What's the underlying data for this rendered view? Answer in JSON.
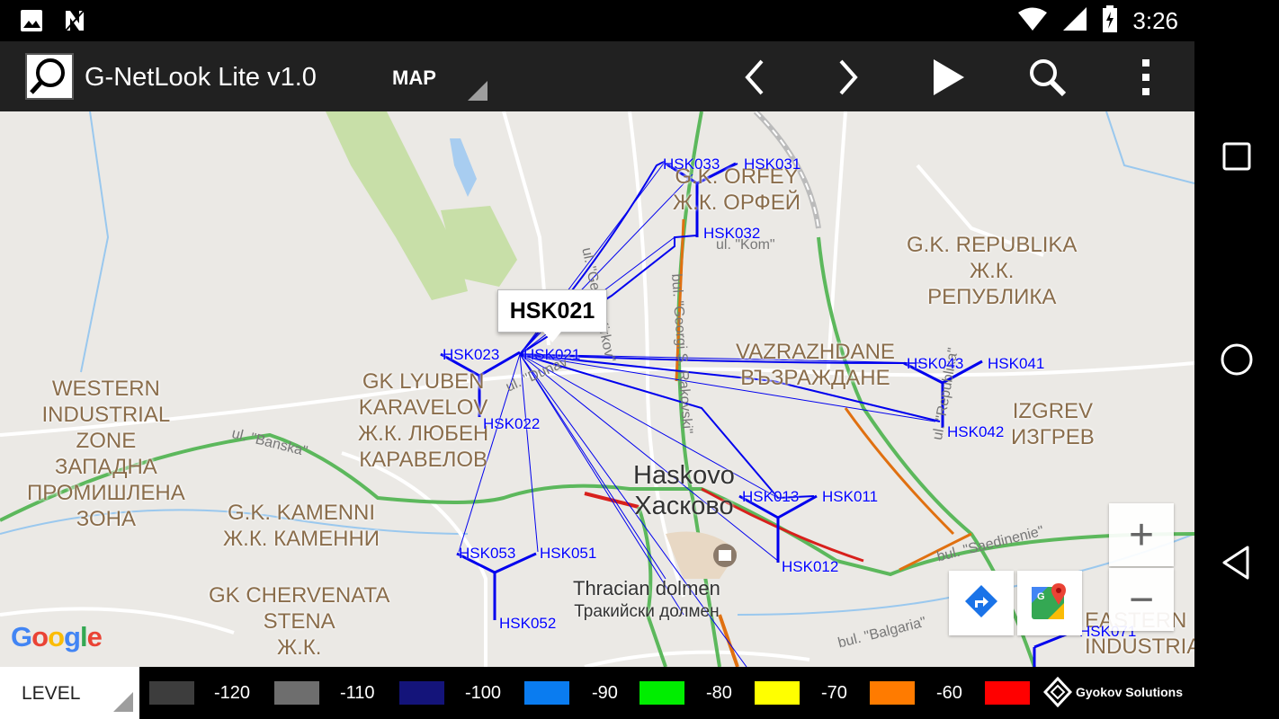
{
  "status_bar": {
    "time": "3:26",
    "icons": [
      "image-icon",
      "n-icon",
      "wifi-icon",
      "signal-icon",
      "battery-charging-icon"
    ]
  },
  "app_bar": {
    "title": "G-NetLook Lite v1.0",
    "view_selector": "MAP",
    "actions": [
      "chevron-left-icon",
      "chevron-right-icon",
      "play-icon",
      "search-icon",
      "more-vert-icon"
    ]
  },
  "map": {
    "info_window": "HSK021",
    "google_logo": "Google",
    "zoom_in": "+",
    "zoom_out": "−",
    "districts": [
      {
        "line1": "G.K. ORFEY",
        "line2": "Ж.К. ОРФЕЙ"
      },
      {
        "line1": "G.K. REPUBLIKA",
        "line2": "Ж.К.",
        "line3": "РЕПУБЛИКА"
      },
      {
        "line1": "VAZRAZHDANE",
        "line2": "ВЪЗРАЖДАНЕ"
      },
      {
        "line1": "GK LYUBEN",
        "line2": "KARAVELOV",
        "line3": "Ж.К. ЛЮБЕН",
        "line4": "КАРАВЕЛОВ"
      },
      {
        "line1": "WESTERN",
        "line2": "INDUSTRIAL",
        "line3": "ZONE",
        "line4": "ЗАПАДНА",
        "line5": "ПРОМИШЛЕНА",
        "line6": "ЗОНА"
      },
      {
        "line1": "IZGREV",
        "line2": "ИЗГРЕВ"
      },
      {
        "line1": "G.K. KAMENNI",
        "line2": "Ж.К. КАМЕННИ"
      },
      {
        "line1": "GK CHERVENATA",
        "line2": "STENA",
        "line3": "Ж.К."
      },
      {
        "line1": "EASTERN",
        "line2": "INDUSTRIA"
      }
    ],
    "city": {
      "line1": "Haskovo",
      "line2": "Хасково"
    },
    "poi": {
      "line1": "Thracian dolmen",
      "line2": "Тракийски долмен"
    },
    "streets": [
      "ul. \"Georgi Kirkov\"",
      "bul. \"Georgi S. Rakovski\"",
      "ul. \"Kom\"",
      "ul. \"Dunav\"",
      "ul. \"Banska\"",
      "ul. \"Republika\"",
      "bul. \"Saedinenie\"",
      "bul. \"Balgaria\""
    ],
    "sites": [
      "HSK033",
      "HSK031",
      "HSK032",
      "HSK023",
      "HSK021",
      "HSK022",
      "HSK043",
      "HSK041",
      "HSK042",
      "HSK013",
      "HSK011",
      "HSK012",
      "HSK053",
      "HSK051",
      "HSK052",
      "HSK071"
    ]
  },
  "legend": {
    "selector": "LEVEL",
    "items": [
      {
        "label": "-120",
        "color": "#3d3d3d"
      },
      {
        "label": "-110",
        "color": "#6e6e6e"
      },
      {
        "label": "-100",
        "color": "#14147a"
      },
      {
        "label": "-90",
        "color": "#0a7cf0"
      },
      {
        "label": "-80",
        "color": "#00ee00"
      },
      {
        "label": "-70",
        "color": "#ffff00"
      },
      {
        "label": "-60",
        "color": "#ff7b00"
      },
      {
        "label": "",
        "color": "#ff0000"
      }
    ],
    "brand": "Gyokov Solutions"
  }
}
